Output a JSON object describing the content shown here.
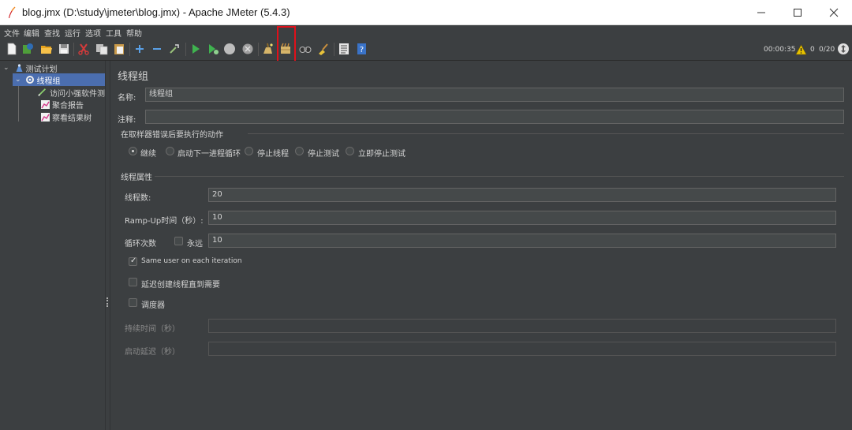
{
  "window": {
    "title": "blog.jmx (D:\\study\\jmeter\\blog.jmx) - Apache JMeter (5.4.3)"
  },
  "menubar": {
    "items": [
      "文件",
      "编辑",
      "查找",
      "运行",
      "选项",
      "工具",
      "帮助"
    ]
  },
  "toolbar": {
    "icons": [
      "new-icon",
      "templates-icon",
      "open-icon",
      "save-icon",
      "cut-icon",
      "copy-icon",
      "paste-icon",
      "expand-icon",
      "collapse-icon",
      "toggle-icon",
      "start-icon",
      "start-no-pause-icon",
      "stop-icon",
      "shutdown-icon",
      "clear-icon",
      "clear-all-icon",
      "search-icon",
      "reset-search-icon",
      "function-helper-icon",
      "help-icon"
    ],
    "highlighted": "clear-all-icon"
  },
  "status": {
    "timer": "00:00:35",
    "warnings": "0",
    "threads": "0/20",
    "accent": "#e8c200"
  },
  "tree": {
    "items": [
      {
        "label": "测试计划",
        "icon": "test-plan-icon"
      },
      {
        "label": "线程组",
        "icon": "thread-group-gear-icon"
      },
      {
        "label": "访问小强软件测",
        "icon": "http-sampler-pen-icon"
      },
      {
        "label": "聚合报告",
        "icon": "listener-chart-icon"
      },
      {
        "label": "察看结果树",
        "icon": "listener-chart-icon"
      }
    ],
    "selected_color": "#4b6eaf"
  },
  "panel": {
    "title": "线程组",
    "name_label": "名称:",
    "name_value": "线程组",
    "comment_label": "注释:",
    "comment_value": "",
    "error_section": "在取样器错误后要执行的动作",
    "error_options": [
      "继续",
      "启动下一进程循环",
      "停止线程",
      "停止测试",
      "立即停止测试"
    ],
    "error_selected": 0,
    "thread_section": "线程属性",
    "threads_label": "线程数:",
    "threads_value": "20",
    "rampup_label": "Ramp-Up时间（秒）:",
    "rampup_value": "10",
    "loop_label": "循环次数",
    "forever_label": "永远",
    "forever_checked": false,
    "loop_value": "10",
    "same_user_label": "Same user on each iteration",
    "same_user_checked": true,
    "delay_label": "延迟创建线程直到需要",
    "delay_checked": false,
    "scheduler_label": "调度器",
    "scheduler_checked": false,
    "duration_label": "持续时间（秒）",
    "duration_value": "",
    "startup_delay_label": "启动延迟（秒）",
    "startup_delay_value": ""
  }
}
